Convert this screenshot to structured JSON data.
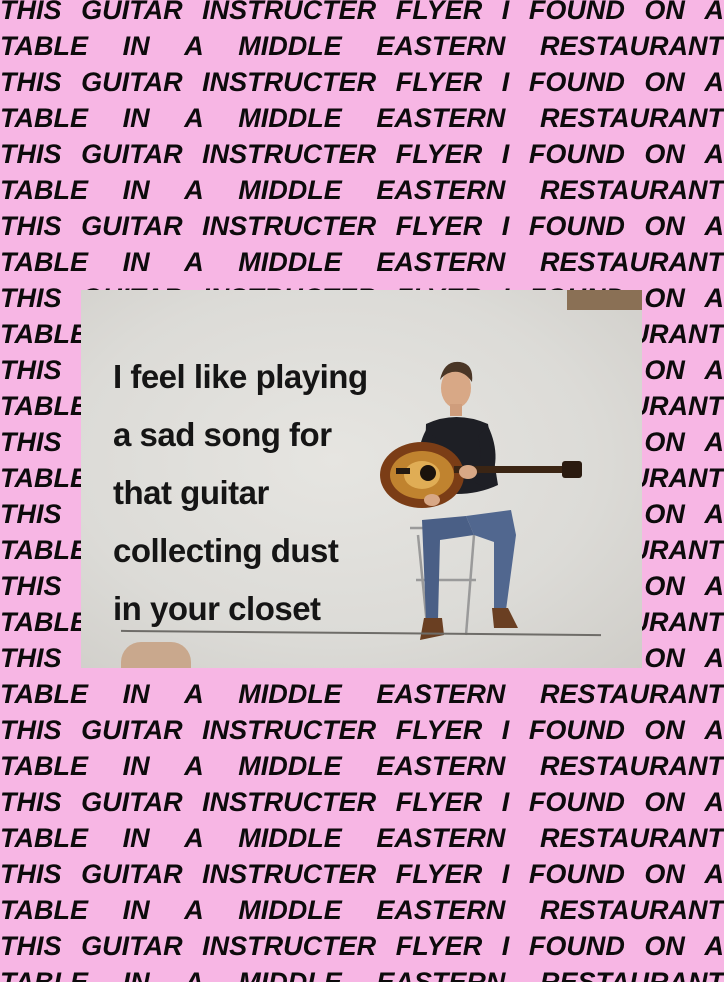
{
  "background": {
    "color": "#f7b6e4",
    "text_color": "#0d0b0c",
    "line_a": [
      "THIS",
      "GUITAR",
      "INSTRUCTER",
      "FLYER",
      "I",
      "FOUND",
      "ON",
      "A"
    ],
    "line_b": [
      "TABLE",
      "IN",
      "A",
      "MIDDLE",
      "EASTERN",
      "RESTAURANT"
    ]
  },
  "photo": {
    "flyer_lines": [
      "I feel like playing",
      "a sad song for",
      "that guitar",
      "collecting dust",
      "in your closet"
    ]
  }
}
